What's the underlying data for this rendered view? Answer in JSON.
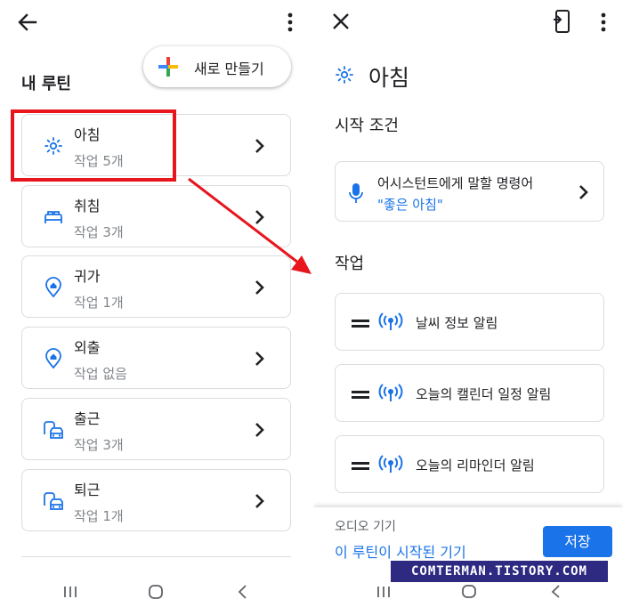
{
  "left": {
    "section_title": "내 루틴",
    "new_button_label": "새로 만들기",
    "routines": [
      {
        "title": "아침",
        "subtitle": "작업 5개",
        "icon": "sun-icon"
      },
      {
        "title": "취침",
        "subtitle": "작업 3개",
        "icon": "bed-icon"
      },
      {
        "title": "귀가",
        "subtitle": "작업 1개",
        "icon": "home-pin-icon"
      },
      {
        "title": "외출",
        "subtitle": "작업 없음",
        "icon": "home-pin-icon"
      },
      {
        "title": "출근",
        "subtitle": "작업 3개",
        "icon": "commute-icon"
      },
      {
        "title": "퇴근",
        "subtitle": "작업 1개",
        "icon": "commute-icon"
      }
    ]
  },
  "right": {
    "title": "아침",
    "start_condition_label": "시작 조건",
    "condition": {
      "title": "어시스턴트에게 말할 명령어",
      "phrase": "\"좋은 아침\""
    },
    "tasks_label": "작업",
    "tasks": [
      "날씨 정보 알림",
      "오늘의 캘린더 일정 알림",
      "오늘의 리마인더 알림"
    ],
    "audio_device_label": "오디오 기기",
    "audio_device_value": "이 루틴이 시작된 기기",
    "save_label": "저장"
  },
  "watermark": "COMTERMAN.TISTORY.COM",
  "colors": {
    "accent": "#1a73e8",
    "highlight_box": "#e8151d",
    "arrow": "#e8151d",
    "watermark_bg": "#2e2a82",
    "watermark_text": "#ffffff"
  }
}
